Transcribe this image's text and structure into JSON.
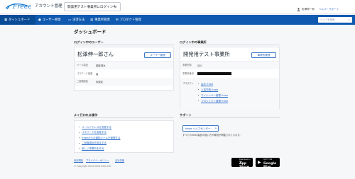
{
  "header": {
    "logo_text": "Freee",
    "account_title": "アカウント管理",
    "office_select_value": "開発用テスト事業所にログイン中",
    "user_name": "松澤伸一郎",
    "help_label": "ヘルプ・サポート"
  },
  "nav": {
    "items": [
      {
        "label": "ダッシュボード",
        "icon": "grid-icon"
      },
      {
        "label": "ユーザー管理",
        "icon": "user-icon"
      },
      {
        "label": "決済方法",
        "icon": "card-icon"
      },
      {
        "label": "事業所管理",
        "icon": "building-icon"
      },
      {
        "label": "プロダクト管理",
        "icon": "apps-icon"
      }
    ],
    "search_placeholder": "ヘルプを検索"
  },
  "page_title": "ダッシュボード",
  "login_user": {
    "section_label": "ログイン中のユーザー",
    "name": "松澤伸一郎さん",
    "manage_button": "ユーザー管理",
    "rows": [
      {
        "key": "メール認証",
        "value": "認証済み"
      },
      {
        "key": "パスワード強度",
        "value": "高"
      },
      {
        "key": "二段階認証",
        "value": "未設定"
      }
    ]
  },
  "login_office": {
    "section_label": "ログイン中の事業所",
    "name": "開発用テスト事業所",
    "manage_button": "事業所管理",
    "rows": [
      {
        "key": "事業形態",
        "value": "法人"
      },
      {
        "key": "事業所番号",
        "value": ""
      }
    ],
    "products_label": "プロダクト",
    "products": [
      "会計 freee",
      "人事労務 freee",
      "マイナンバー管理 freee",
      "プロジェクト管理 freee"
    ]
  },
  "faq": {
    "section_label": "よく行われる操作",
    "links": [
      "メールアドレスを変更する",
      "パスワードを変更する",
      "freeeからの通知メールを管理する",
      "二段階認証を設定する",
      "新しい事業所を作る"
    ]
  },
  "support": {
    "section_label": "サポート",
    "button": "freee ヘルプセンター",
    "text": "すべてのfreee製品の使い方や解説が掲載されています。"
  },
  "footer": {
    "links": [
      "利用規約",
      "プライバシーポリシー",
      "会社情報"
    ],
    "copyright": "© Copyright 2012-2024 freee K.K.",
    "app_store": {
      "small": "Download on the",
      "big": "App Store"
    },
    "google_play": {
      "small": "GET IT ON",
      "big": "Google Play"
    }
  },
  "colors": {
    "nav_bg": "#0f5ab0",
    "link": "#2f6fc9",
    "page_bg": "#f6f7f9"
  }
}
